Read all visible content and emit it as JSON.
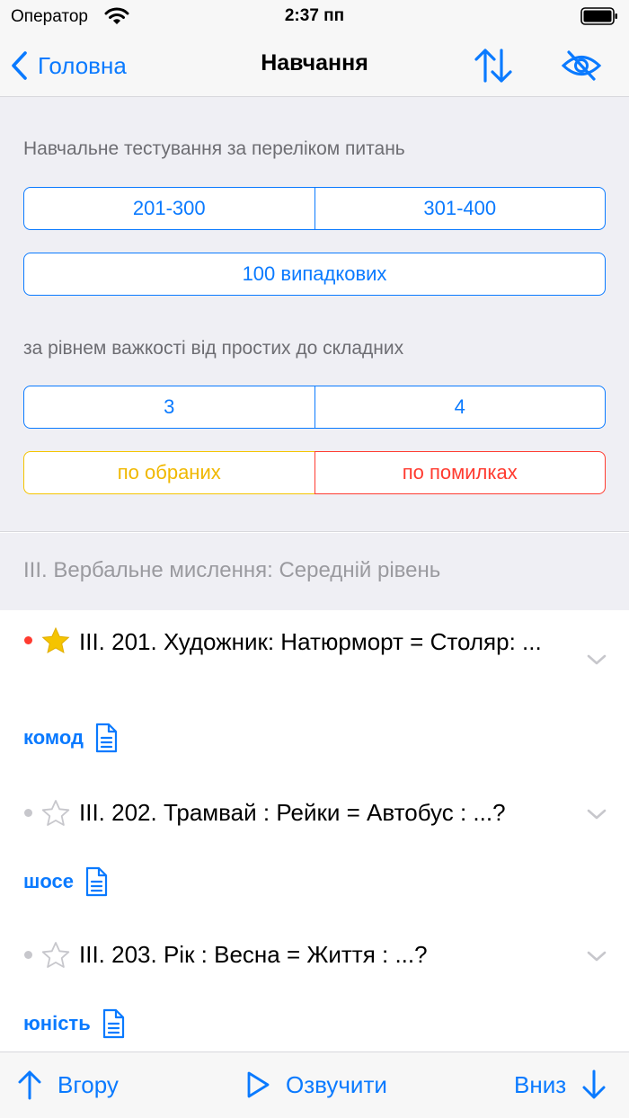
{
  "status": {
    "carrier": "Оператор",
    "time": "2:37 пп"
  },
  "nav": {
    "back_label": "Головна",
    "title": "Навчання"
  },
  "panel": {
    "caption_list": "Навчальне тестування за переліком питань",
    "range_buttons": [
      "201-300",
      "301-400"
    ],
    "random_button": "100 випадкових",
    "caption_level": "за рівнем важкості від простих до складних",
    "level_buttons": [
      "3",
      "4"
    ],
    "favorites_button": "по обраних",
    "mistakes_button": "по помилках"
  },
  "section": {
    "title": "III. Вербальне мислення: Середній рівень"
  },
  "questions": [
    {
      "text": "III. 201. Художник: Натюрморт = Столяр: ...",
      "answer": "комод",
      "favorite": true,
      "dot_color": "#ff3b30"
    },
    {
      "text": "III. 202. Трамвай : Рейки = Автобус : ...?",
      "answer": "шосе",
      "favorite": false,
      "dot_color": "#c7c7cc"
    },
    {
      "text": "III. 203. Рік : Весна = Життя : ...?",
      "answer": "юність",
      "favorite": false,
      "dot_color": "#c7c7cc"
    }
  ],
  "tabbar": {
    "up_label": "Вгору",
    "speak_label": "Озвучити",
    "down_label": "Вниз"
  },
  "colors": {
    "accent": "#0a7aff",
    "favorite": "#f5c400",
    "error": "#ff3b30"
  }
}
